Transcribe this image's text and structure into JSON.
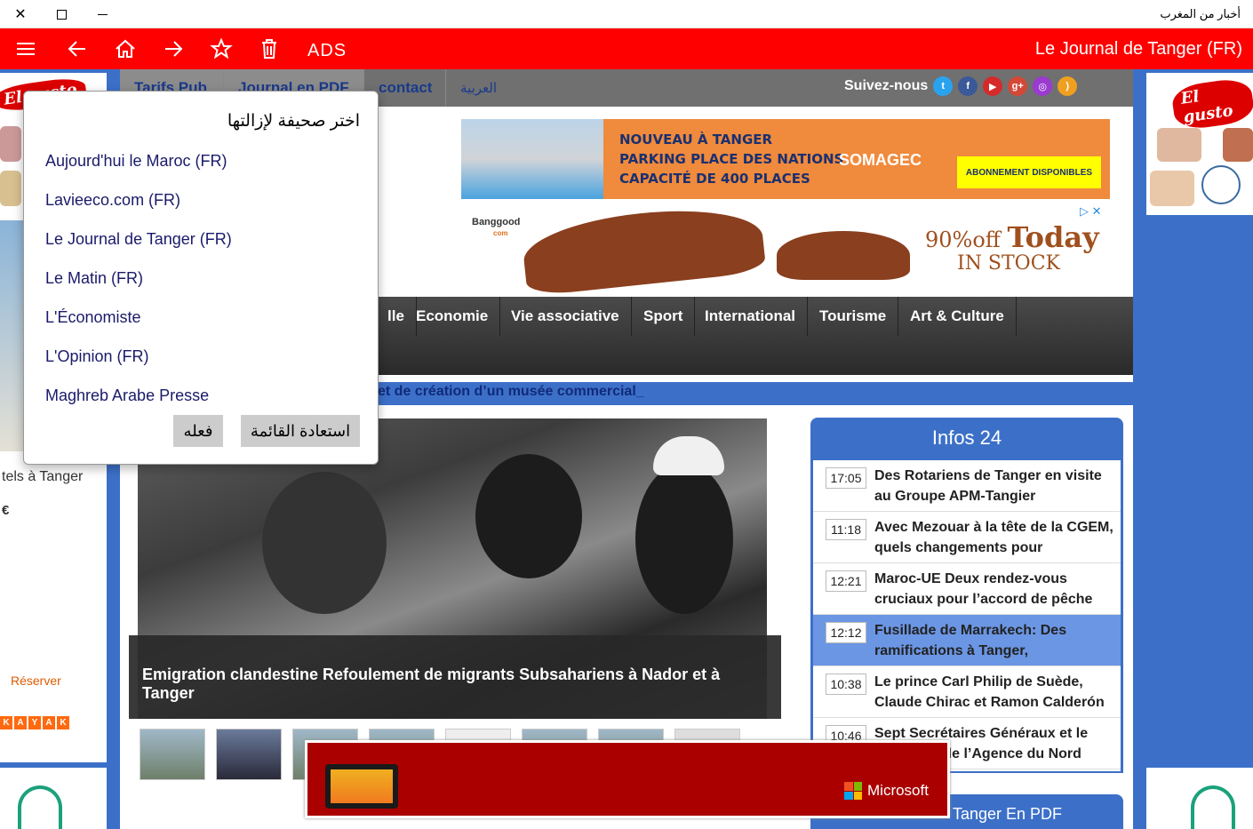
{
  "window": {
    "title": "أخبار من المغرب"
  },
  "toolbar": {
    "ads_label": "ADS",
    "current_paper": "Le Journal de Tanger (FR)"
  },
  "site": {
    "topnav": [
      "Tarifs Pub",
      "Journal en PDF",
      "contact",
      "العربية"
    ],
    "follow_label": "Suivez-nous",
    "ad1": {
      "lines": [
        "NOUVEAU À TANGER",
        "PARKING PLACE DES NATIONS",
        "CAPACITÉ DE 400 PLACES"
      ],
      "brand": "SOMAGEC",
      "cta": "ABONNEMENT DISPONIBLES"
    },
    "ad2": {
      "brand": "Banggood",
      "brand_sub": "com",
      "offer_pct": "90%off",
      "offer_word": "Today",
      "stock": "IN STOCK"
    },
    "categories": [
      "lle",
      "Economie",
      "Vie associative",
      "Sport",
      "International",
      "Tourisme",
      "Art & Culture"
    ],
    "ticker": "et de création d’un musée commercial_",
    "hero_caption": "Emigration clandestine Refoulement de migrants Subsahariens à Nador et à Tanger",
    "left_panel": {
      "hotel": "tels à Tanger",
      "price": "€",
      "reserve": "Réserver",
      "kayak": [
        "K",
        "A",
        "Y",
        "A",
        "K"
      ]
    },
    "elgusto": "El gusto",
    "infos": {
      "title": "Infos 24",
      "items": [
        {
          "time": "17:05",
          "title": "Des Rotariens de Tanger en visite au Groupe APM-Tangier"
        },
        {
          "time": "11:18",
          "title": "Avec Mezouar à la tête de la CGEM, quels changements pour"
        },
        {
          "time": "12:21",
          "title": "Maroc-UE Deux rendez-vous cruciaux pour l’accord de pêche"
        },
        {
          "time": "12:12",
          "title": "Fusillade de Marrakech: Des ramifications à Tanger,"
        },
        {
          "time": "10:38",
          "title": "Le prince Carl Philip de Suède, Claude Chirac et Ramon Calderón"
        },
        {
          "time": "10:46",
          "title": "Sept Secrétaires Généraux et le Président de l’Agence du Nord"
        }
      ]
    },
    "pdf_header": "Tanger En PDF",
    "ms_ad": {
      "brand": "Microsoft"
    }
  },
  "flyout": {
    "title": "اختر صحيفة لإزالتها",
    "items": [
      "Aujourd'hui le Maroc (FR)",
      "Lavieeco.com (FR)",
      "Le Journal de Tanger (FR)",
      "Le Matin (FR)",
      "L'Économiste",
      "L'Opinion (FR)",
      "Maghreb Arabe Presse"
    ],
    "restore_label": "استعادة القائمة",
    "do_label": "فعله"
  }
}
